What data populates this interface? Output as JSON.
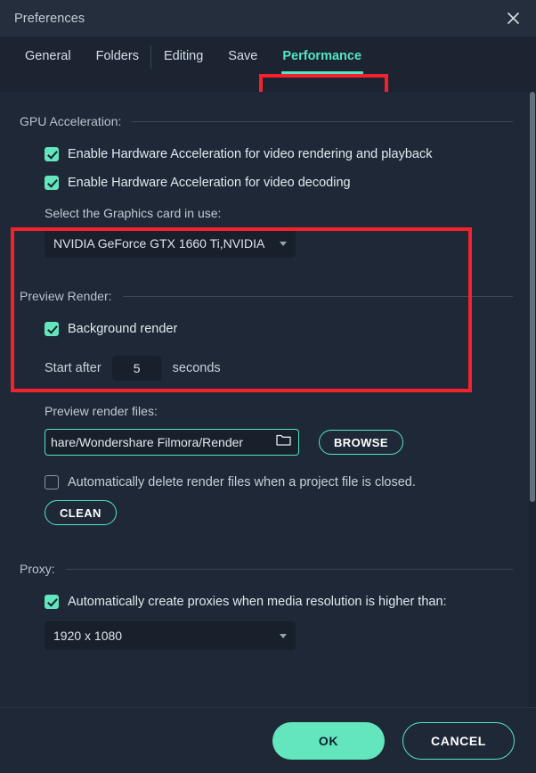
{
  "window": {
    "title": "Preferences",
    "close_icon": "close-icon"
  },
  "tabs": [
    {
      "label": "General",
      "active": false
    },
    {
      "label": "Folders",
      "active": false
    },
    {
      "label": "Editing",
      "active": false
    },
    {
      "label": "Save",
      "active": false
    },
    {
      "label": "Performance",
      "active": true
    }
  ],
  "sections": {
    "gpu": {
      "heading": "GPU Acceleration:",
      "checkbox_render": {
        "label": "Enable Hardware Acceleration for video rendering and playback",
        "checked": true
      },
      "checkbox_decode": {
        "label": "Enable Hardware Acceleration for video decoding",
        "checked": true
      },
      "graphics_card_label": "Select the Graphics card in use:",
      "graphics_card_value": "NVIDIA GeForce GTX 1660 Ti,NVIDIA"
    },
    "preview_render": {
      "heading": "Preview Render:",
      "checkbox_background": {
        "label": "Background render",
        "checked": true
      },
      "start_after_prefix": "Start after",
      "start_after_value": "5",
      "start_after_suffix": "seconds",
      "files_label": "Preview render files:",
      "path_value": "hare/Wondershare Filmora/Render",
      "folder_icon": "folder-icon",
      "browse_label": "BROWSE",
      "auto_delete": {
        "label": "Automatically delete render files when a project file is closed.",
        "checked": false
      },
      "clean_label": "CLEAN"
    },
    "proxy": {
      "heading": "Proxy:",
      "checkbox_auto_proxy": {
        "label": "Automatically create proxies when media resolution is higher than:",
        "checked": true
      },
      "resolution_value": "1920 x 1080"
    }
  },
  "footer": {
    "ok_label": "OK",
    "cancel_label": "CANCEL"
  },
  "colors": {
    "accent": "#55e6c1",
    "accent_fill": "#63e6be",
    "highlight_box": "#f5222d",
    "panel_bg": "#1e2836",
    "titlebar_bg": "#242e3c",
    "field_bg": "#17202b"
  }
}
